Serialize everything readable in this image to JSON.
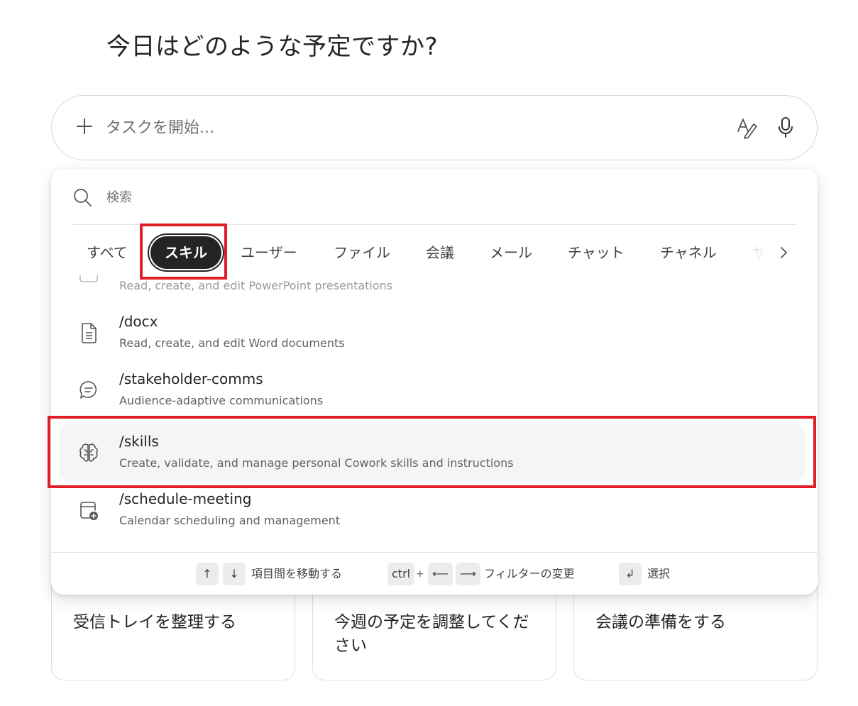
{
  "greeting": "今日はどのような予定ですか?",
  "composer": {
    "placeholder": "タスクを開始...",
    "add_icon": "plus-icon",
    "style_icon": "text-style-icon",
    "mic_icon": "microphone-icon"
  },
  "cards": [
    {
      "text": "受信トレイを整理する"
    },
    {
      "text": "今週の予定を調整してください"
    },
    {
      "text": "会議の準備をする"
    }
  ],
  "popup": {
    "search_placeholder": "検索",
    "tabs": [
      {
        "label": "すべて"
      },
      {
        "label": "スキル",
        "active": true
      },
      {
        "label": "ユーザー"
      },
      {
        "label": "ファイル"
      },
      {
        "label": "会議"
      },
      {
        "label": "メール"
      },
      {
        "label": "チャット"
      },
      {
        "label": "チャネル"
      },
      {
        "label": "サ-"
      }
    ],
    "items": [
      {
        "name": "",
        "desc": "Read, create, and edit PowerPoint presentations",
        "icon": "presentation-icon"
      },
      {
        "name": "/docx",
        "desc": "Read, create, and edit Word documents",
        "icon": "document-icon"
      },
      {
        "name": "/stakeholder-comms",
        "desc": "Audience-adaptive communications",
        "icon": "chat-bubble-icon"
      },
      {
        "name": "/skills",
        "desc": "Create, validate, and manage personal Cowork skills and instructions",
        "icon": "brain-icon"
      },
      {
        "name": "/schedule-meeting",
        "desc": "Calendar scheduling and management",
        "icon": "calendar-add-icon"
      }
    ],
    "footer": {
      "up_key": "↑",
      "down_key": "↓",
      "navigate_hint": "項目間を移動する",
      "ctrl_key": "ctrl",
      "plus": "+",
      "left_key": "⟵",
      "right_key": "⟶",
      "filter_hint": "フィルターの変更",
      "enter_key": "↲",
      "select_hint": "選択"
    }
  },
  "colors": {
    "highlight": "#e01e26",
    "active_tab_bg": "#242424"
  }
}
